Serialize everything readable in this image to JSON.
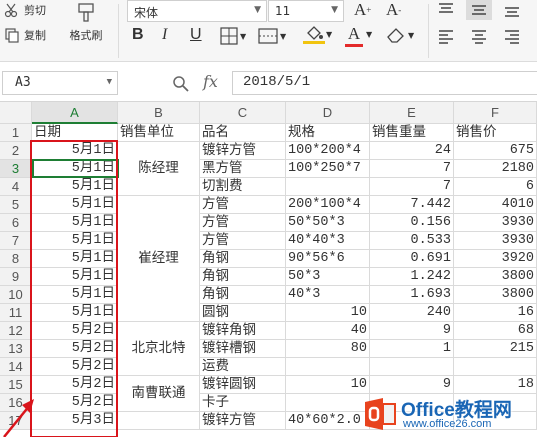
{
  "ribbon": {
    "cut_label": "剪切",
    "copy_label": "复制",
    "format_painter_label": "格式刷",
    "font_name": "宋体",
    "font_size": "11",
    "bold": "B",
    "italic": "I",
    "underline": "U",
    "grow_font": "A",
    "shrink_font": "A",
    "font_color_glyph": "A"
  },
  "formula_bar": {
    "cell_ref": "A3",
    "fx_label": "fx",
    "value": "2018/5/1"
  },
  "columns": [
    "A",
    "B",
    "C",
    "D",
    "E",
    "F"
  ],
  "rows": [
    {
      "n": "1",
      "a": "日期",
      "c": "品名",
      "d": "规格",
      "e": "销售重量",
      "f": "销售价",
      "b": "销售单位"
    },
    {
      "n": "2",
      "a": "5月1日",
      "c": "镀锌方管",
      "d": "100*200*4",
      "e": "24",
      "f": "675"
    },
    {
      "n": "3",
      "a": "5月1日",
      "c": "黑方管",
      "d": "100*250*7",
      "e": "7",
      "f": "2180"
    },
    {
      "n": "4",
      "a": "5月1日",
      "c": "切割费",
      "d": "",
      "e": "7",
      "f": "6"
    },
    {
      "n": "5",
      "a": "5月1日",
      "c": "方管",
      "d": "200*100*4",
      "e": "7.442",
      "f": "4010"
    },
    {
      "n": "6",
      "a": "5月1日",
      "c": "方管",
      "d": "50*50*3",
      "e": "0.156",
      "f": "3930"
    },
    {
      "n": "7",
      "a": "5月1日",
      "c": "方管",
      "d": "40*40*3",
      "e": "0.533",
      "f": "3930"
    },
    {
      "n": "8",
      "a": "5月1日",
      "c": "角钢",
      "d": "90*56*6",
      "e": "0.691",
      "f": "3920"
    },
    {
      "n": "9",
      "a": "5月1日",
      "c": "角钢",
      "d": "50*3",
      "e": "1.242",
      "f": "3800"
    },
    {
      "n": "10",
      "a": "5月1日",
      "c": "角钢",
      "d": "40*3",
      "e": "1.693",
      "f": "3800"
    },
    {
      "n": "11",
      "a": "5月1日",
      "c": "圆钢",
      "d": "10",
      "e": "240",
      "f": "16"
    },
    {
      "n": "12",
      "a": "5月2日",
      "c": "镀锌角钢",
      "d": "40",
      "e": "9",
      "f": "68"
    },
    {
      "n": "13",
      "a": "5月2日",
      "c": "镀锌槽钢",
      "d": "80",
      "e": "1",
      "f": "215"
    },
    {
      "n": "14",
      "a": "5月2日",
      "c": "运费",
      "d": "",
      "e": "",
      "f": ""
    },
    {
      "n": "15",
      "a": "5月2日",
      "c": "镀锌圆钢",
      "d": "10",
      "e": "9",
      "f": "18"
    },
    {
      "n": "16",
      "a": "5月2日",
      "c": "卡子",
      "d": "",
      "e": "",
      "f": ""
    },
    {
      "n": "17",
      "a": "5月3日",
      "c": "镀锌方管",
      "d": "40*60*2.0",
      "e": "",
      "f": ""
    }
  ],
  "merged_units": [
    {
      "label": "陈经理"
    },
    {
      "label": "崔经理"
    },
    {
      "label": "北京北特"
    },
    {
      "label": "南曹联通"
    }
  ],
  "watermark": {
    "brand": "Office教程网",
    "url": "www.office26.com"
  }
}
